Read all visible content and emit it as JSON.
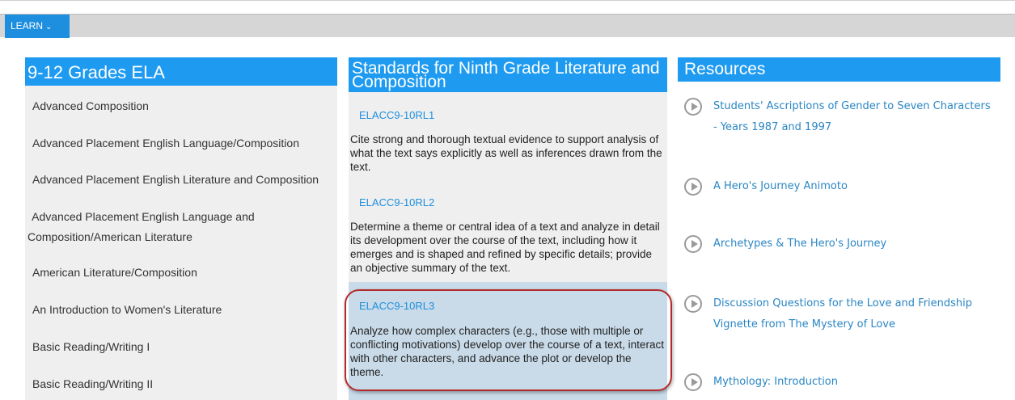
{
  "nav": {
    "learn_label": "LEARN"
  },
  "col1": {
    "title": "9-12 Grades ELA",
    "courses": [
      "Advanced Composition",
      "Advanced Placement English Language/Composition",
      "Advanced Placement English Literature and Composition",
      " Advanced Placement English Language and",
      "Composition/American Literature",
      "American Literature/Composition",
      "An Introduction to Women's Literature",
      "Basic Reading/Writing I",
      "Basic Reading/Writing II"
    ]
  },
  "col2": {
    "title": "Standards for Ninth Grade Literature and Composition",
    "standards": [
      {
        "code": "ELACC9-10RL1",
        "text": " Cite strong and thorough textual evidence to support analysis of what the text says explicitly as well as inferences drawn from the text."
      },
      {
        "code": "ELACC9-10RL2",
        "text": " Determine a theme or central idea of a text and analyze in detail its development over the course of the text, including how it emerges and is shaped and refined by specific details; provide an objective summary of the text."
      },
      {
        "code": "ELACC9-10RL3",
        "text": " Analyze how complex characters (e.g., those with multiple or conflicting motivations) develop over the course of a text, interact with other characters, and advance the plot or develop the theme."
      }
    ]
  },
  "col3": {
    "title": "Resources",
    "resources": [
      "Students' Ascriptions of Gender to Seven Characters - Years 1987 and 1997",
      "A Hero's Journey Animoto",
      "Archetypes & The Hero's Journey",
      "Discussion Questions for the Love and Friendship Vignette from The Mystery of Love",
      "Mythology: Introduction"
    ]
  }
}
